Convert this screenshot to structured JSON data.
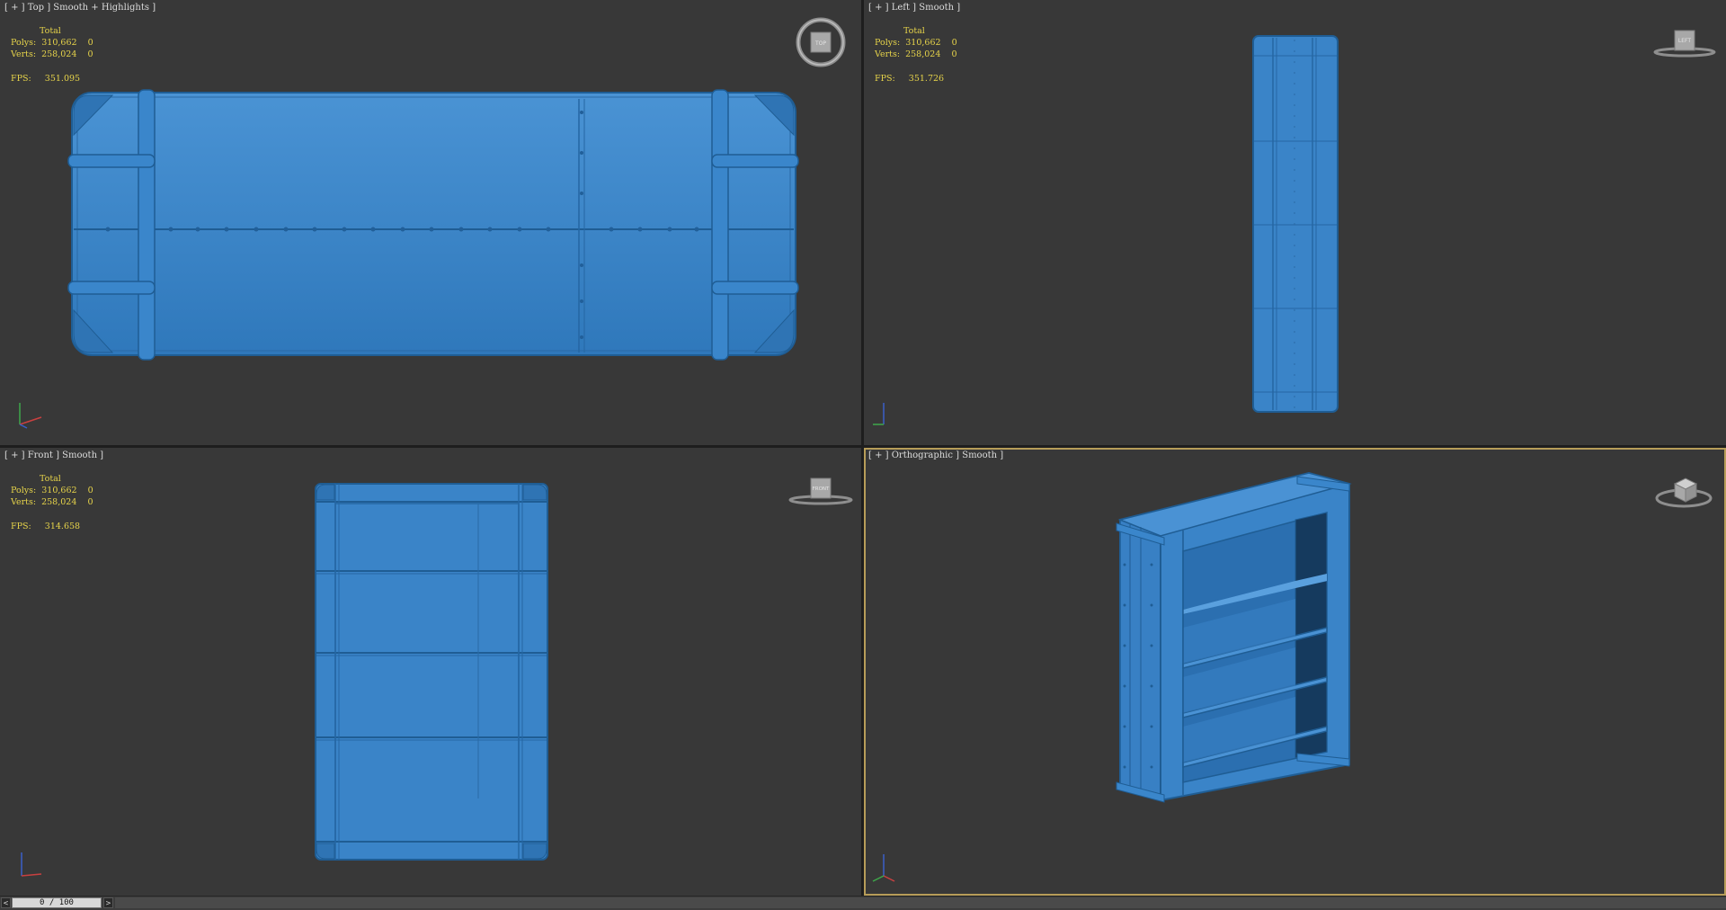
{
  "viewports": {
    "top": {
      "label": "[ + ] Top ] Smooth + Highlights ]",
      "total": "Total",
      "polys": "Polys:  310,662    0",
      "verts": "Verts:  258,024    0",
      "fps": "FPS:     351.095",
      "cube": "TOP"
    },
    "left": {
      "label": "[ + ] Left ] Smooth ]",
      "total": "Total",
      "polys": "Polys:  310,662    0",
      "verts": "Verts:  258,024    0",
      "fps": "FPS:     351.726",
      "cube": "LEFT"
    },
    "front": {
      "label": "[ + ] Front ] Smooth ]",
      "total": "Total",
      "polys": "Polys:  310,662    0",
      "verts": "Verts:  258,024    0",
      "fps": "FPS:     314.658",
      "cube": "FRONT"
    },
    "ortho": {
      "label": "[ + ] Orthographic ] Smooth ]"
    }
  },
  "timeline": {
    "frame": "0 / 100",
    "prev": "<",
    "next": ">"
  },
  "colors": {
    "model": "#3a83c6",
    "viewport_bg": "#383838",
    "active_border": "#b79d59",
    "stats_text": "#e7d44a"
  },
  "icons": [
    "view-cube-icon",
    "axis-tripod-icon"
  ]
}
